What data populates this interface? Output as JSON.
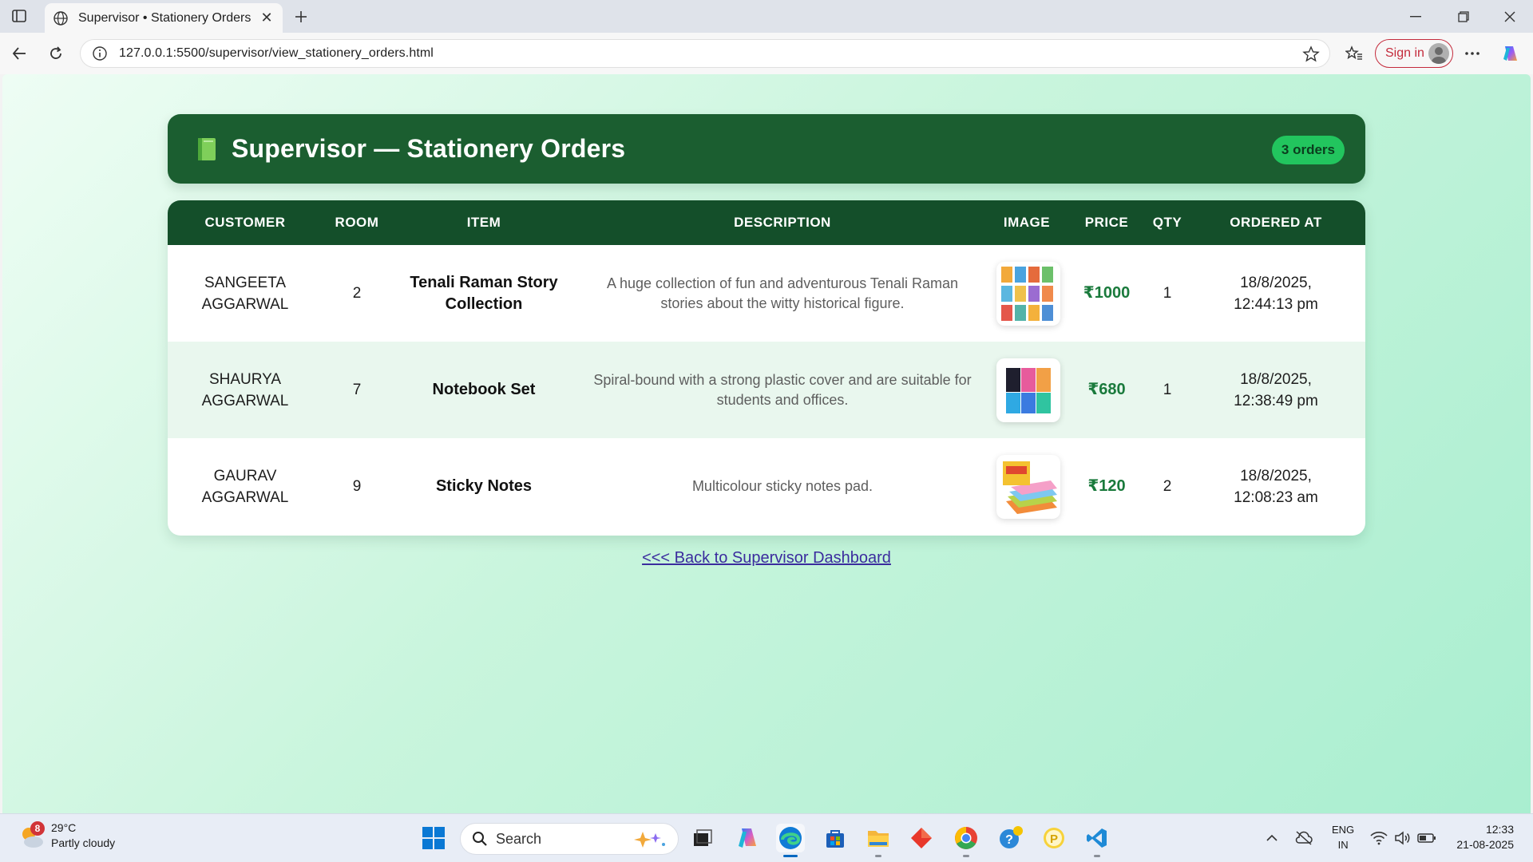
{
  "browser": {
    "tab_title": "Supervisor • Stationery Orders",
    "url": "127.0.0.1:5500/supervisor/view_stationery_orders.html",
    "sign_in_label": "Sign in"
  },
  "page": {
    "title": "Supervisor — Stationery Orders",
    "order_count_badge": "3 orders",
    "columns": [
      "CUSTOMER",
      "ROOM",
      "ITEM",
      "DESCRIPTION",
      "IMAGE",
      "PRICE",
      "QTY",
      "ORDERED AT"
    ],
    "orders": [
      {
        "customer_line1": "SANGEETA",
        "customer_line2": "AGGARWAL",
        "room": "2",
        "item": "Tenali Raman Story Collection",
        "description": "A huge collection of fun and adventurous Tenali Raman stories about the witty historical figure.",
        "image_icon": "book-collection-thumbnail",
        "price": "₹1000",
        "qty": "1",
        "ordered_date": "18/8/2025,",
        "ordered_time": "12:44:13 pm"
      },
      {
        "customer_line1": "SHAURYA",
        "customer_line2": "AGGARWAL",
        "room": "7",
        "item": "Notebook Set",
        "description": "Spiral-bound with a strong plastic cover and are suitable for students and offices.",
        "image_icon": "notebook-set-thumbnail",
        "price": "₹680",
        "qty": "1",
        "ordered_date": "18/8/2025,",
        "ordered_time": "12:38:49 pm"
      },
      {
        "customer_line1": "GAURAV",
        "customer_line2": "AGGARWAL",
        "room": "9",
        "item": "Sticky Notes",
        "description": "Multicolour sticky notes pad.",
        "image_icon": "sticky-notes-thumbnail",
        "price": "₹120",
        "qty": "2",
        "ordered_date": "18/8/2025,",
        "ordered_time": "12:08:23 am"
      }
    ],
    "back_link": "<<< Back to Supervisor Dashboard"
  },
  "taskbar": {
    "weather_temp": "29°C",
    "weather_desc": "Partly cloudy",
    "weather_badge": "8",
    "search_placeholder": "Search",
    "lang_line1": "ENG",
    "lang_line2": "IN",
    "time": "12:33",
    "date": "21-08-2025"
  },
  "colors": {
    "header_bg": "#1b5e30",
    "table_header_bg": "#144f2a",
    "badge_bg": "#22c55e",
    "price_text": "#1a7a3c",
    "alt_row_bg": "#e9f7ee",
    "link": "#3b2c9e"
  }
}
